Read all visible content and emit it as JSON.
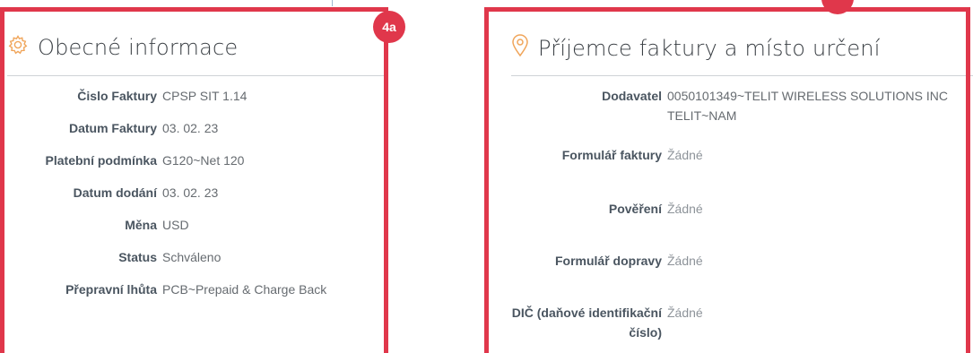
{
  "left_panel": {
    "title": "Obecné informace",
    "icon": "gear-icon",
    "rows": [
      {
        "label": "Čislo Faktury",
        "value": "CPSP SIT 1.14"
      },
      {
        "label": "Datum Faktury",
        "value": "03. 02. 23"
      },
      {
        "label": "Platební podmínka",
        "value": "G120~Net 120"
      },
      {
        "label": "Datum dodání",
        "value": "03. 02. 23"
      },
      {
        "label": "Měna",
        "value": "USD"
      },
      {
        "label": "Status",
        "value": "Schváleno"
      },
      {
        "label": "Přepravní lhůta",
        "value": "PCB~Prepaid & Charge Back"
      }
    ]
  },
  "right_panel": {
    "title": "Příjemce faktury a místo určení",
    "icon": "location-pin-icon",
    "rows": [
      {
        "label": "Dodavatel",
        "value": "0050101349~TELIT WIRELESS SOLUTIONS INC TELIT~NAM"
      },
      {
        "label": "Formulář faktury",
        "value": "Žádné"
      },
      {
        "label": "Pověření",
        "value": "Žádné"
      },
      {
        "label": "Formulář dopravy",
        "value": "Žádné"
      },
      {
        "label": "DIČ (daňové identifikační číslo)",
        "value": "Žádné"
      }
    ]
  },
  "annotations": {
    "badge_left": "4a"
  },
  "colors": {
    "highlight": "#e0374b",
    "icon_accent": "#f0a55a"
  }
}
